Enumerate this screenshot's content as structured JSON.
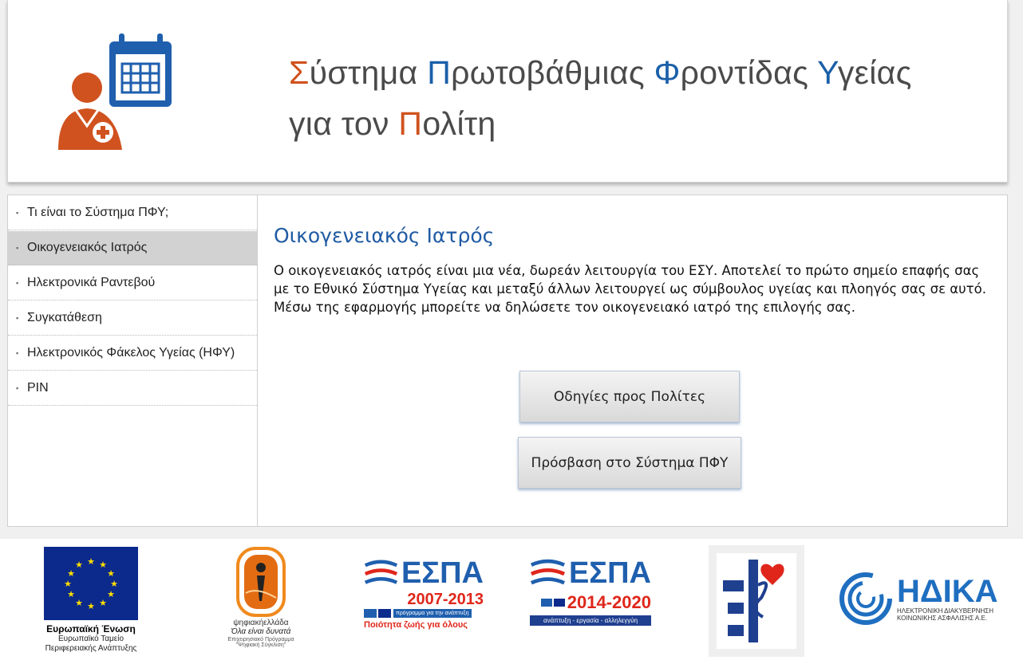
{
  "header": {
    "title_line1": [
      {
        "initial": "Σ",
        "rest": "ύστημα ",
        "color": "orange"
      },
      {
        "initial": "Π",
        "rest": "ρωτοβάθμιας ",
        "color": "blue"
      },
      {
        "initial": "Φ",
        "rest": "ροντίδας ",
        "color": "blue"
      },
      {
        "initial": "Υ",
        "rest": "γείας",
        "color": "blue"
      }
    ],
    "title_line2_pre": "για τον ",
    "title_line2_initial": "Π",
    "title_line2_rest": "ολίτη",
    "accent_orange": "#d0521e",
    "accent_blue": "#1a5fa8"
  },
  "sidebar": {
    "items": [
      {
        "label": "Τι είναι το Σύστημα ΠΦΥ;",
        "active": false
      },
      {
        "label": "Οικογενειακός Ιατρός",
        "active": true
      },
      {
        "label": "Ηλεκτρονικά Ραντεβού",
        "active": false
      },
      {
        "label": "Συγκατάθεση",
        "active": false
      },
      {
        "label": "Ηλεκτρονικός Φάκελος Υγείας (ΗΦΥ)",
        "active": false
      },
      {
        "label": "PIN",
        "active": false
      }
    ]
  },
  "main": {
    "title": "Οικογενειακός Ιατρός",
    "text": "Ο οικογενειακός ιατρός είναι μια νέα, δωρεάν λειτουργία του ΕΣΥ. Αποτελεί το πρώτο σημείο επαφής σας με το Εθνικό Σύστημα Υγείας και μεταξύ άλλων λειτουργεί ως σύμβουλος υγείας και πλοηγός σας σε αυτό. Μέσω της εφαρμογής μπορείτε να δηλώσετε τον οικογενειακό ιατρό της επιλογής σας.",
    "button_guide": "Οδηγίες προς Πολίτες",
    "button_access": "Πρόσβαση στο Σύστημα ΠΦΥ"
  },
  "footer": {
    "eu_title": "Ευρωπαϊκή Ένωση",
    "eu_sub1": "Ευρωπαϊκό Ταμείο",
    "eu_sub2": "Περιφερειακής Ανάπτυξης",
    "digital_brand": "ψηφιακήελλάδα",
    "digital_slogan": "Όλα είναι δυνατά",
    "digital_sub1": "Επιχειρησιακό Πρόγραμμα",
    "digital_sub2": "\"Ψηφιακή Σύγκλιση\"",
    "espa1_name": "ΕΣΠΑ",
    "espa1_years": "2007-2013",
    "espa1_band": "πρόγραμμα για την ανάπτυξη",
    "espa1_slogan": "Ποιότητα ζωής για όλους",
    "espa2_name": "ΕΣΠΑ",
    "espa2_years": "2014-2020",
    "espa2_slogan": "ανάπτυξη - εργασία - αλληλεγγύη",
    "idika_name": "ΗΔΙΚΑ",
    "idika_sub1": "ΗΛΕΚΤΡΟΝΙΚΗ ΔΙΑΚΥΒΕΡΝΗΣΗ",
    "idika_sub2": "ΚΟΙΝΩΝΙΚΗΣ ΑΣΦΑΛΙΣΗΣ Α.Ε."
  }
}
